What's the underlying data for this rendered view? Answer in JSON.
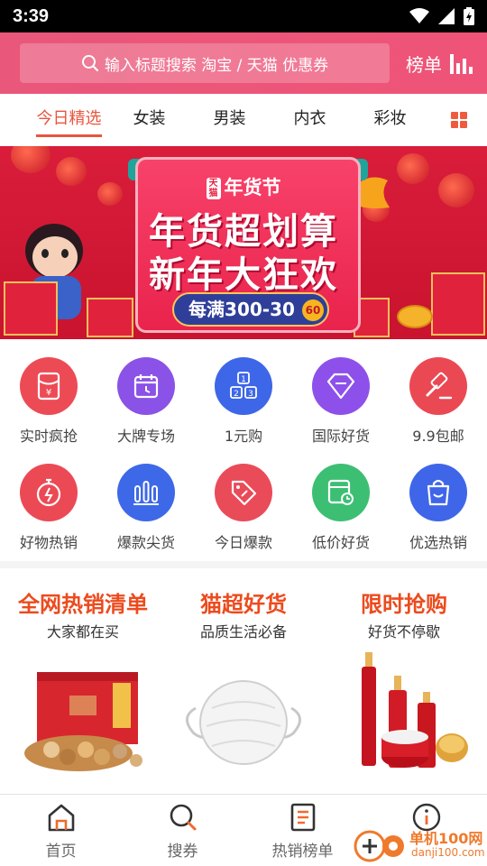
{
  "status_bar": {
    "time": "3:39"
  },
  "header": {
    "search_placeholder": "输入标题搜索 淘宝 / 天猫 优惠券",
    "rank_label": "榜单",
    "accent": "#ec5478"
  },
  "tabs": [
    {
      "label": "今日精选",
      "active": true
    },
    {
      "label": "女装"
    },
    {
      "label": "男装"
    },
    {
      "label": "内衣"
    },
    {
      "label": "彩妆"
    }
  ],
  "banner": {
    "tmall_mark": "天猫",
    "festival": "年货节",
    "headline_1": "年货超划算",
    "headline_2": "新年大狂欢",
    "offer": "每满300-30",
    "coin": "60"
  },
  "quick_links": [
    {
      "label": "实时疯抢",
      "icon": "red-envelope-icon",
      "color": "#ec4b55"
    },
    {
      "label": "大牌专场",
      "icon": "calendar-clock-icon",
      "color": "#8a52e6"
    },
    {
      "label": "1元购",
      "icon": "number-blocks-icon",
      "color": "#3d67e8"
    },
    {
      "label": "国际好货",
      "icon": "diamond-icon",
      "color": "#8e50ea"
    },
    {
      "label": "9.9包邮",
      "icon": "auction-hammer-icon",
      "color": "#ea4953"
    },
    {
      "label": "好物热销",
      "icon": "stopwatch-icon",
      "color": "#eb4a55"
    },
    {
      "label": "爆款尖货",
      "icon": "bar-chart-icon",
      "color": "#3d69e8"
    },
    {
      "label": "今日爆款",
      "icon": "price-tag-icon",
      "color": "#ea4b58"
    },
    {
      "label": "低价好货",
      "icon": "receipt-clock-icon",
      "color": "#3cbf73"
    },
    {
      "label": "优选热销",
      "icon": "shopping-bag-icon",
      "color": "#3f66e9"
    }
  ],
  "promo": [
    {
      "title": "全网热销清单",
      "subtitle": "大家都在买",
      "image": "snack-gift-box"
    },
    {
      "title": "猫超好货",
      "subtitle": "品质生活必备",
      "image": "face-mask"
    },
    {
      "title": "限时抢购",
      "subtitle": "好货不停歇",
      "image": "cosmetics-set"
    }
  ],
  "bottom_nav": [
    {
      "label": "首页",
      "icon": "home-icon",
      "active": true
    },
    {
      "label": "搜券",
      "icon": "search-icon"
    },
    {
      "label": "热销榜单",
      "icon": "list-document-icon"
    },
    {
      "label": "",
      "icon": "info-icon"
    }
  ],
  "watermark": {
    "name": "单机100网",
    "url": "danji100.com"
  }
}
